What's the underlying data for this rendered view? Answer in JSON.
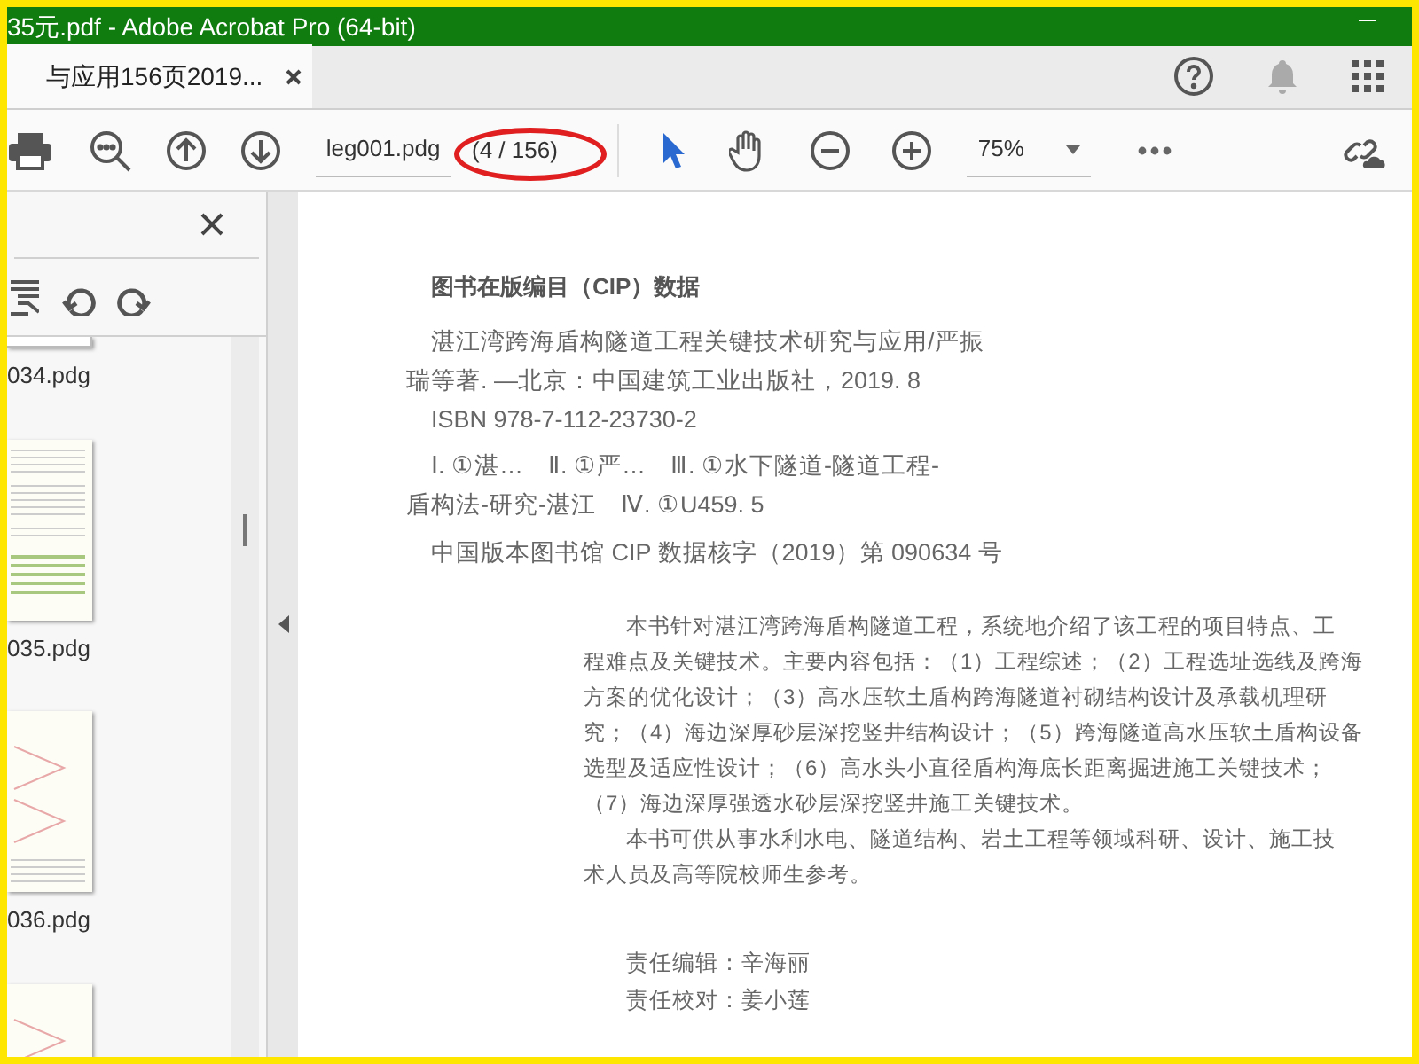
{
  "window": {
    "title": "35元.pdf - Adobe Acrobat Pro (64-bit)"
  },
  "tabs": [
    {
      "label": "与应用156页2019...",
      "selected": true
    }
  ],
  "toolbar": {
    "file_name": "leg001.pdg",
    "page_count": "(4 / 156)",
    "zoom": "75%"
  },
  "thumbnails": [
    {
      "label": "034.pdg",
      "kind": "blank"
    },
    {
      "label": "035.pdg",
      "kind": "table"
    },
    {
      "label": "036.pdg",
      "kind": "chart"
    },
    {
      "kind": "chart"
    }
  ],
  "page": {
    "heading": "图书在版编目（CIP）数据",
    "cip_lines": [
      "湛江湾跨海盾构隧道工程关键技术研究与应用/严振",
      "瑞等著. —北京：中国建筑工业出版社，2019. 8",
      "ISBN 978-7-112-23730-2",
      "Ⅰ. ①湛…　Ⅱ. ①严…　Ⅲ. ①水下隧道-隧道工程-",
      "盾构法-研究-湛江　Ⅳ. ①U459. 5",
      "中国版本图书馆 CIP 数据核字（2019）第 090634 号"
    ],
    "summary_lines": [
      "本书针对湛江湾跨海盾构隧道工程，系统地介绍了该工程的项目特点、工",
      "程难点及关键技术。主要内容包括：（1）工程综述；（2）工程选址选线及跨海",
      "方案的优化设计；（3）高水压软土盾构跨海隧道衬砌结构设计及承载机理研",
      "究；（4）海边深厚砂层深挖竖井结构设计；（5）跨海隧道高水压软土盾构设备",
      "选型及适应性设计；（6）高水头小直径盾构海底长距离掘进施工关键技术；",
      "（7）海边深厚强透水砂层深挖竖井施工关键技术。",
      "本书可供从事水利水电、隧道结构、岩土工程等领域科研、设计、施工技",
      "术人员及高等院校师生参考。"
    ],
    "credits": [
      "责任编辑：辛海丽",
      "责任校对：姜小莲"
    ]
  }
}
